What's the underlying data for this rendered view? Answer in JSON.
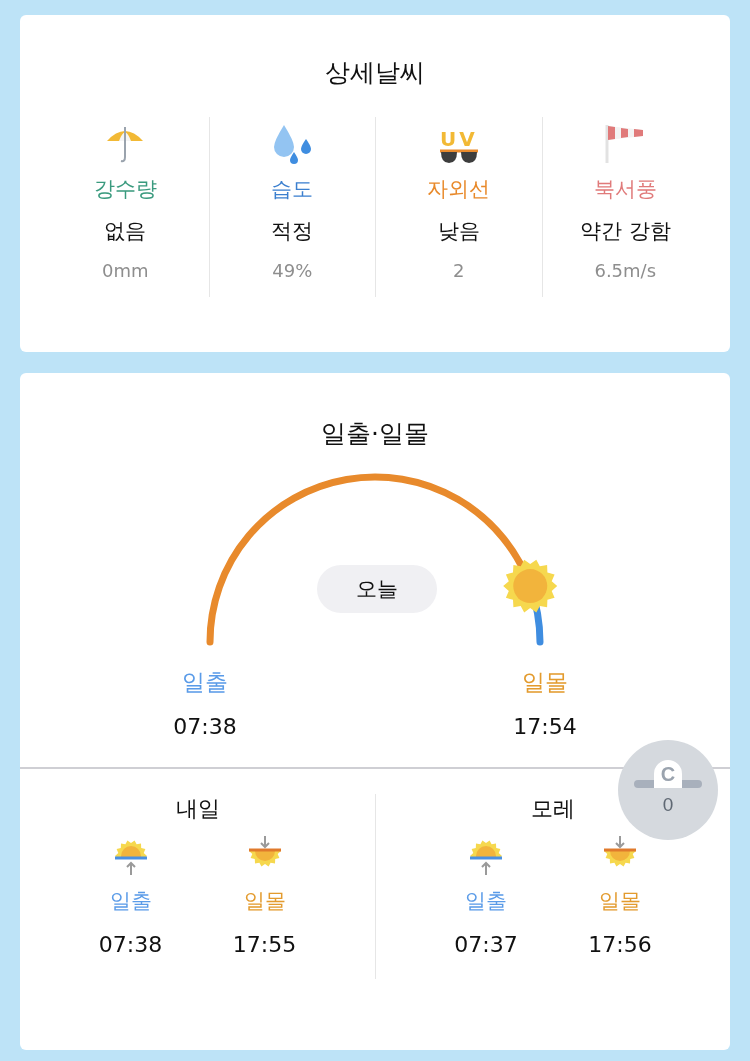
{
  "details": {
    "title": "상세날씨",
    "items": [
      {
        "kind": "umbrella",
        "label": "강수량",
        "color": "#3a9a7e",
        "value": "없음",
        "reading": "0mm"
      },
      {
        "kind": "drops",
        "label": "습도",
        "color": "#3b7fcf",
        "value": "적정",
        "reading": "49%"
      },
      {
        "kind": "uv",
        "icon_text": "UV",
        "label": "자외선",
        "color": "#e8892a",
        "value": "낮음",
        "reading": "2"
      },
      {
        "kind": "windsock",
        "label": "북서풍",
        "color": "#e07a7a",
        "value": "약간 강함",
        "reading": "6.5m/s"
      }
    ]
  },
  "sun": {
    "title": "일출·일몰",
    "today": {
      "label": "오늘",
      "sunrise_label": "일출",
      "sunrise": "07:38",
      "sunset_label": "일몰",
      "sunset": "17:54"
    },
    "days": [
      {
        "title": "내일",
        "events": [
          {
            "kind": "sunrise",
            "label": "일출",
            "time": "07:38"
          },
          {
            "kind": "sunset",
            "label": "일몰",
            "time": "17:55"
          }
        ]
      },
      {
        "title": "모레",
        "events": [
          {
            "kind": "sunrise",
            "label": "일출",
            "time": "07:37"
          },
          {
            "kind": "sunset",
            "label": "일몰",
            "time": "17:56"
          }
        ]
      }
    ]
  },
  "floating_widget": {
    "icon_text": "C",
    "count": "0"
  }
}
